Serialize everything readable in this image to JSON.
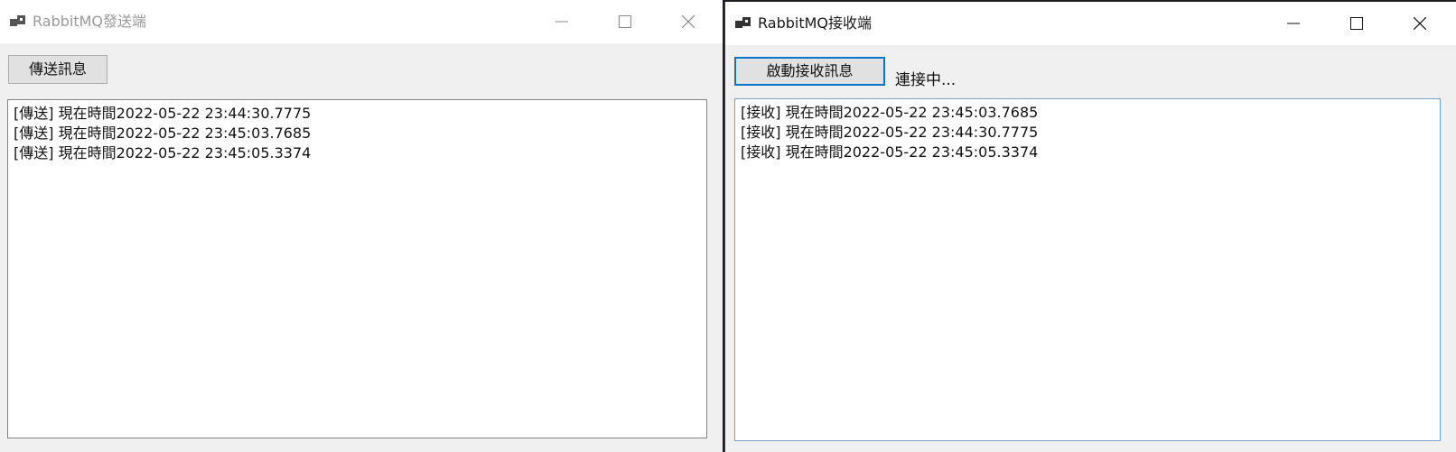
{
  "sender": {
    "title": "RabbitMQ發送端",
    "send_button": "傳送訊息",
    "messages": [
      "[傳送] 現在時間2022-05-22 23:44:30.7775",
      "[傳送] 現在時間2022-05-22 23:45:03.7685",
      "[傳送] 現在時間2022-05-22 23:45:05.3374"
    ]
  },
  "receiver": {
    "title": "RabbitMQ接收端",
    "start_button": "啟動接收訊息",
    "status": "連接中...",
    "messages": [
      "[接收] 現在時間2022-05-22 23:45:03.7685",
      "[接收] 現在時間2022-05-22 23:44:30.7775",
      "[接收] 現在時間2022-05-22 23:45:05.3374"
    ]
  },
  "colors": {
    "title_inactive": "#999999",
    "title_active": "#1a1a1a",
    "focus_border": "#0a75c9"
  },
  "icons": [
    "app-icon",
    "minimize-icon",
    "maximize-icon",
    "close-icon"
  ]
}
